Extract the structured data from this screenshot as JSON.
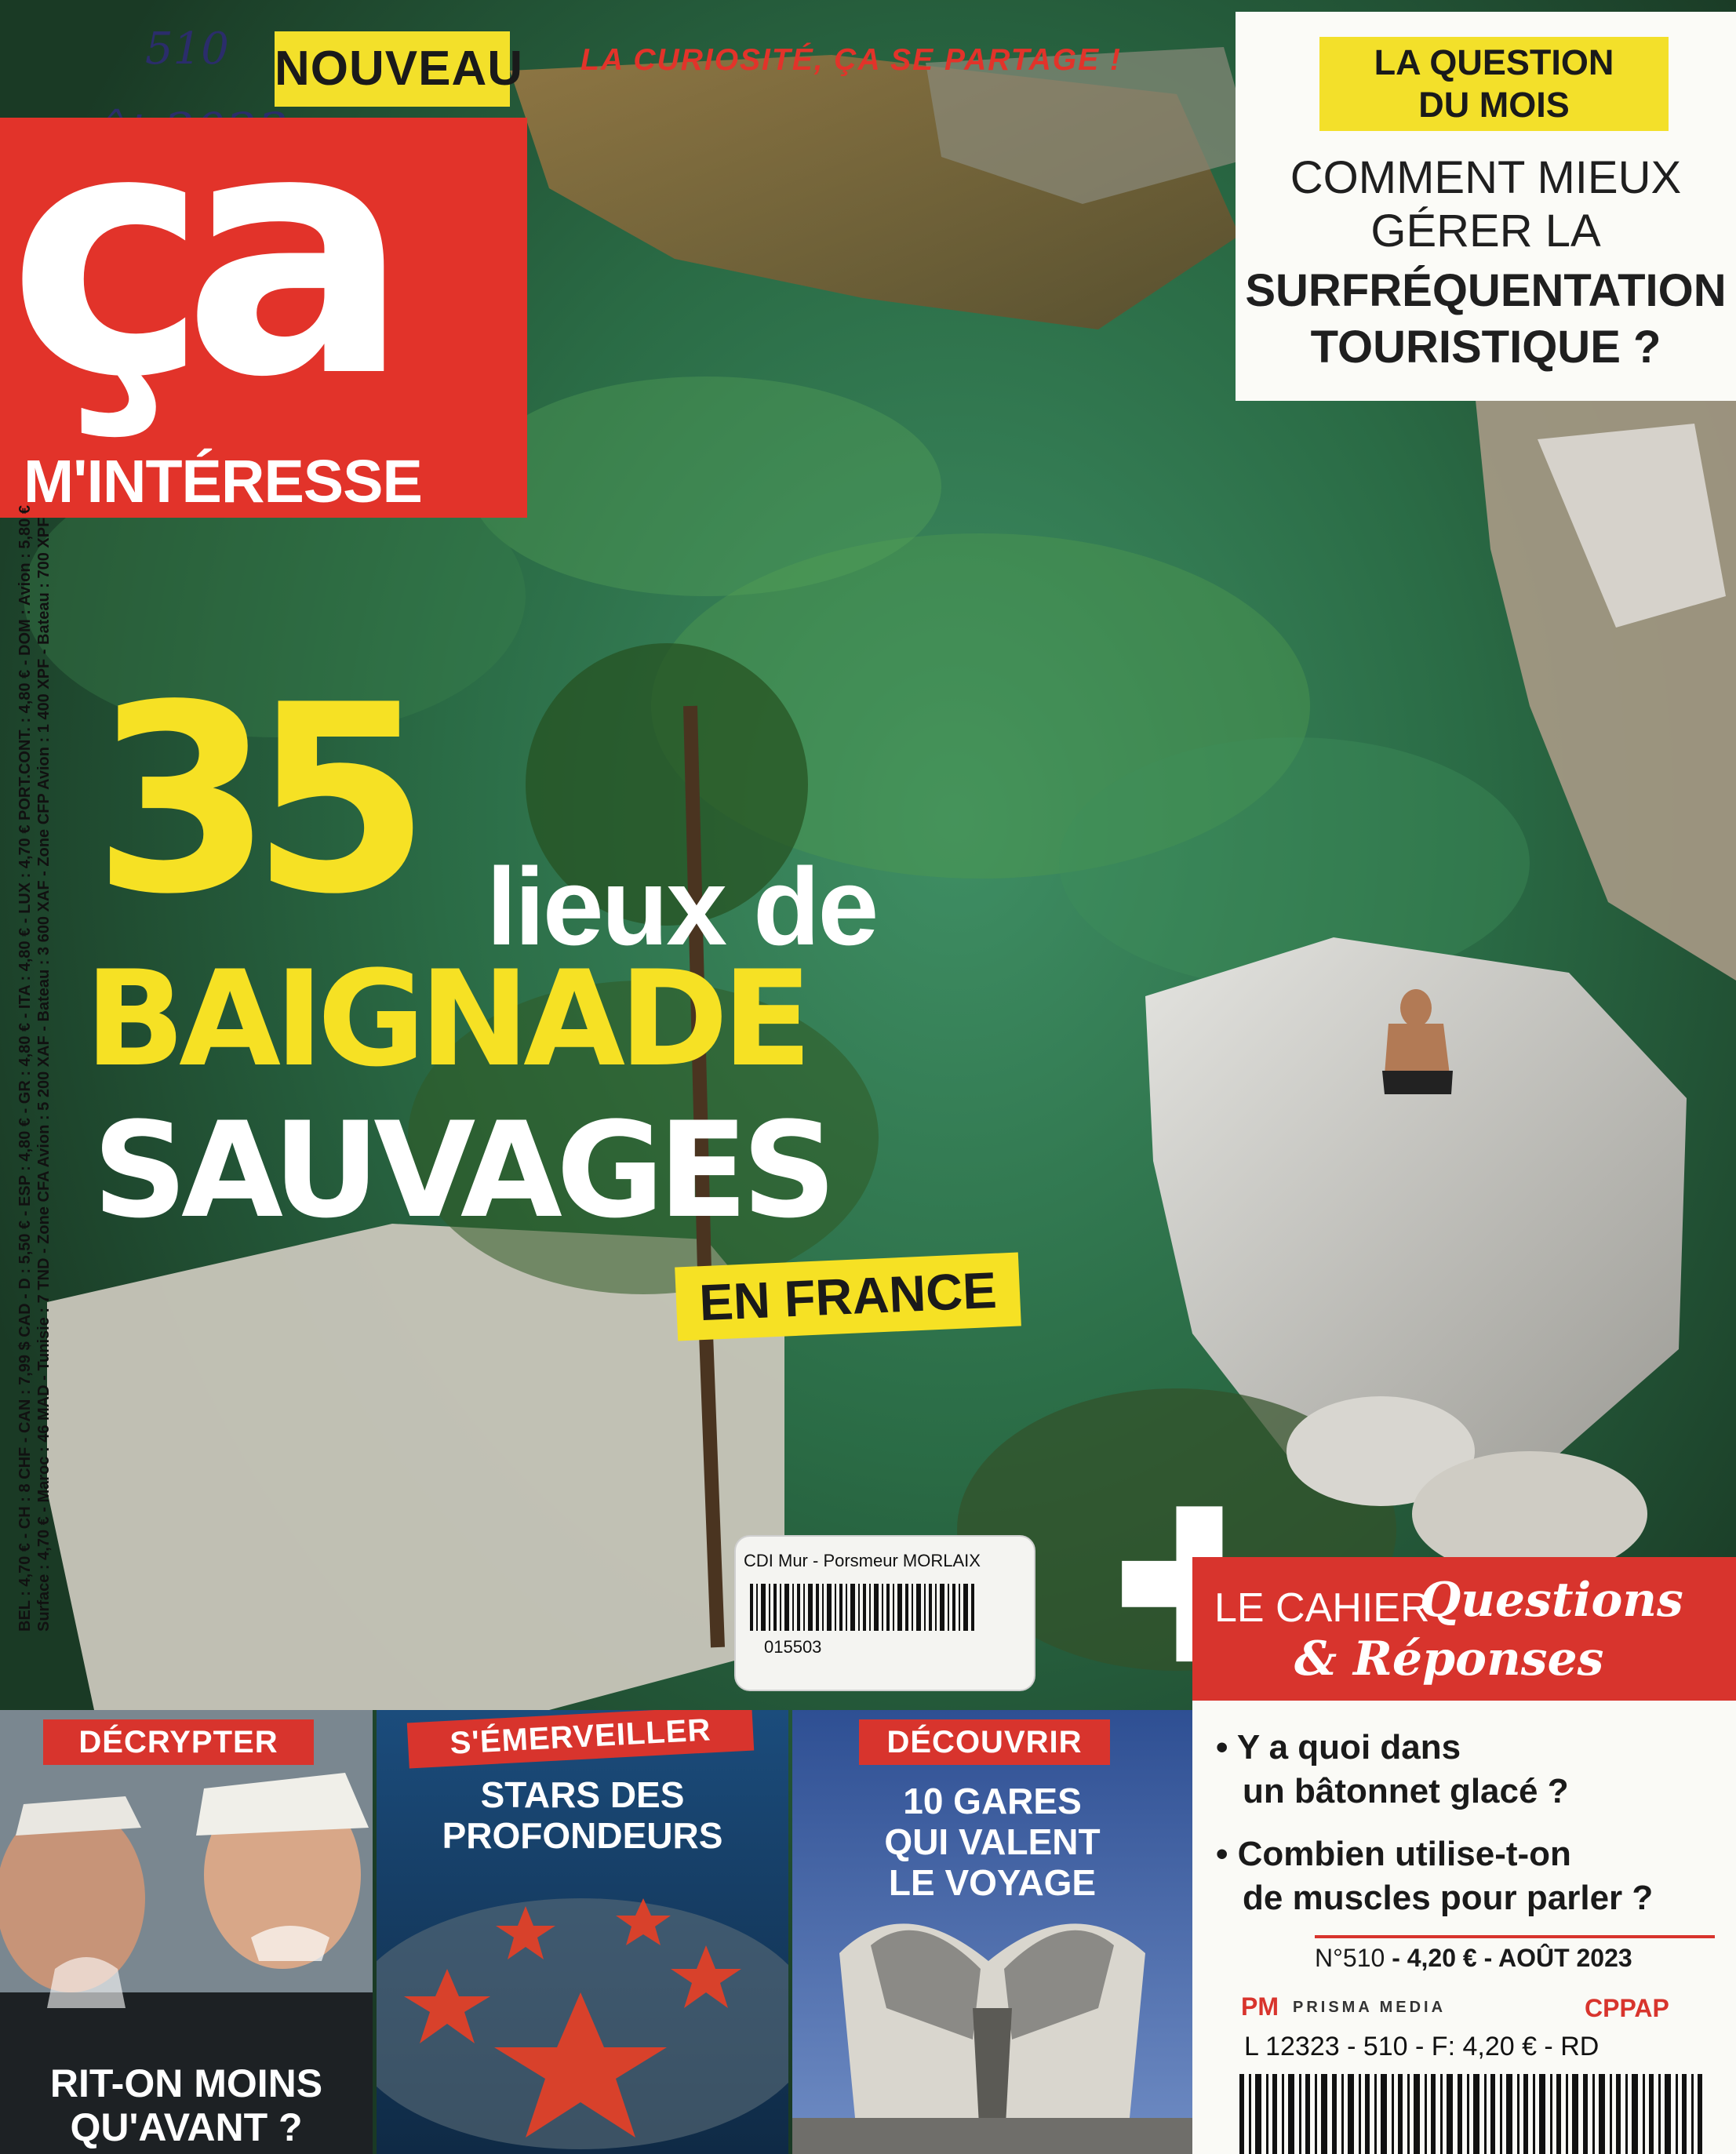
{
  "handwritten_note": {
    "line1": "510",
    "line2": "août 2023"
  },
  "masthead": {
    "nouveau_banner": "NOUVEAU",
    "tagline": "LA CURIOSITÉ, ÇA SE PARTAGE !",
    "logo_main": "ça",
    "logo_sub": "M'INTÉRESSE"
  },
  "question_du_mois": {
    "label_line1": "LA QUESTION",
    "label_line2": "DU MOIS",
    "line1": "COMMENT MIEUX",
    "line2": "GÉRER LA",
    "line3": "SURFRÉQUENTATION",
    "line4": "TOURISTIQUE ?"
  },
  "price_spine": {
    "line1": "BEL : 4,70 € - CH : 8 CHF - CAN : 7,99 $ CAD - D : 5,50 € - ESP : 4,80 € - GR : 4,80 € - ITA : 4,80 € - LUX : 4,70 € PORT.CONT. : 4,80 € - DOM : Avion : 5,80 €",
    "line2": "Surface : 4,70 € - Maroc : 46 MAD - Tunisie : 7 TND - Zone CFA Avion : 5 200 XAF - Bateau : 3 600 XAF - Zone CFP Avion : 1 400 XPF - Bateau : 700 XPF"
  },
  "headline": {
    "number": "35",
    "line1": "lieux de",
    "line2": "BAIGNADE",
    "line3": "SAUVAGES",
    "tag": "EN FRANCE"
  },
  "library_sticker": {
    "line1": "CDI Mur - Porsmeur MORLAIX",
    "line2": "015503"
  },
  "cahier": {
    "prefix": "LE CAHIER",
    "title1": "Questions",
    "title2": "& Réponses"
  },
  "qa_items": [
    {
      "line1": "• Y a quoi dans",
      "line2": "un bâtonnet glacé ?"
    },
    {
      "line1": "• Combien utilise-t-on",
      "line2": "de muscles pour parler ?"
    }
  ],
  "issue": {
    "number": "N°510",
    "price_date": "- 4,20 € - AOÛT 2023"
  },
  "publisher": {
    "logo": "PM",
    "name": "PRISMA MEDIA",
    "cppap": "CPPAP"
  },
  "barcode_line": "L 12323 - 510 - F: 4,20 € - RD",
  "panels": [
    {
      "tag": "DÉCRYPTER",
      "title_line1": "RIT-ON MOINS",
      "title_line2": "QU'AVANT ?"
    },
    {
      "tag": "S'ÉMERVEILLER",
      "title_line1": "STARS DES",
      "title_line2": "PROFONDEURS"
    },
    {
      "tag": "DÉCOUVRIR",
      "title_line1": "10 GARES",
      "title_line2": "QUI VALENT",
      "title_line3": "LE VOYAGE"
    }
  ],
  "colors": {
    "brand_red": "#e2332a",
    "highlight_yellow": "#f6e124",
    "water_green": "#2f6a3a"
  }
}
